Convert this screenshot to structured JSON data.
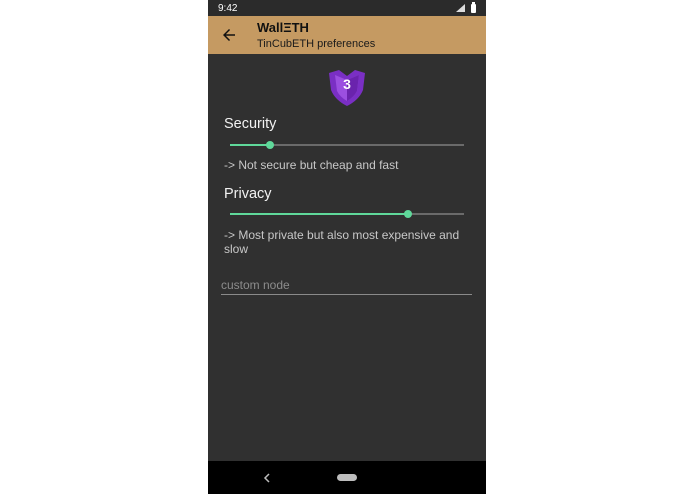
{
  "status_bar": {
    "time": "9:42"
  },
  "app_bar": {
    "title": "WallΞTH",
    "subtitle": "TinCubETH preferences",
    "accent_color": "#c59a62"
  },
  "badge": {
    "icon": "shield-badge-icon",
    "number": "3"
  },
  "security": {
    "title": "Security",
    "slider_value": 0.17,
    "description": "-> Not secure but cheap and fast"
  },
  "privacy": {
    "title": "Privacy",
    "slider_value": 0.76,
    "description": "-> Most private but also most expensive and slow"
  },
  "custom_node": {
    "placeholder": "custom node",
    "value": ""
  },
  "colors": {
    "slider": "#5fd89a",
    "background": "#303030"
  }
}
